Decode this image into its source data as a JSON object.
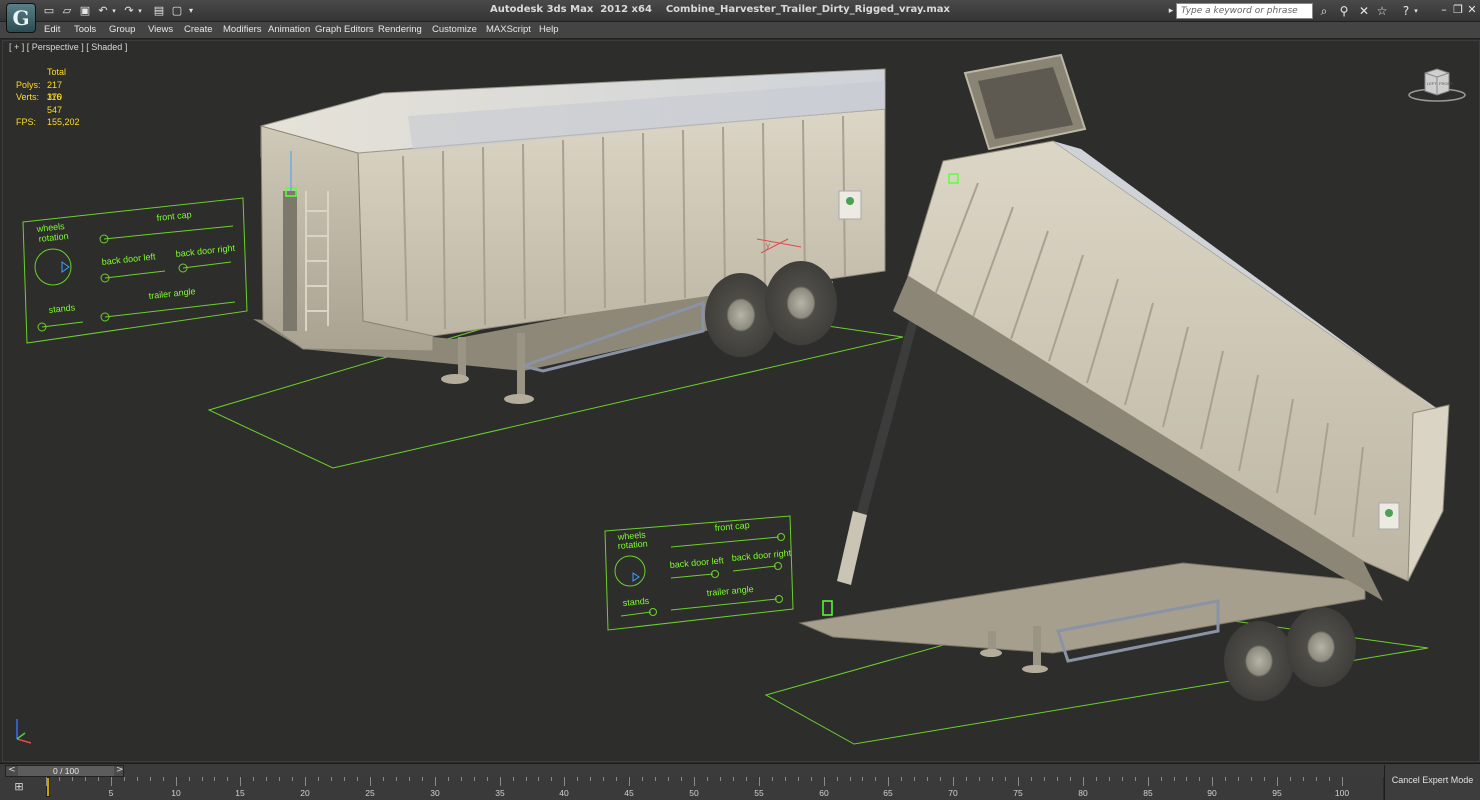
{
  "app": {
    "logo_glyph": "G",
    "title": "Autodesk 3ds Max  2012 x64    Combine_Harvester_Trailer_Dirty_Rigged_vray.max",
    "search_placeholder": "Type a keyword or phrase"
  },
  "quick_access": {
    "icons": [
      "new-file-icon",
      "open-folder-icon",
      "save-icon",
      "undo-icon",
      "redo-icon",
      "project-folder-icon",
      "viewport-layout-icon",
      "customize-dropdown-icon"
    ]
  },
  "menu": {
    "items": [
      "Edit",
      "Tools",
      "Group",
      "Views",
      "Create",
      "Modifiers",
      "Animation",
      "Graph Editors",
      "Rendering",
      "Customize",
      "MAXScript",
      "Help"
    ]
  },
  "viewport": {
    "label": "[ + ] [ Perspective ] [ Shaded ]",
    "stats": {
      "total_label": "Total",
      "polys_label": "Polys:",
      "polys_value": "217 370",
      "verts_label": "Verts:",
      "verts_value": "116 547",
      "fps_label": "FPS:",
      "fps_value": "155,202"
    },
    "viewcube": {
      "left_face": "LEFT",
      "front_face": "FRONT"
    },
    "rig_panel_1": {
      "wheels_line1": "wheels",
      "wheels_line2": "rotation",
      "front_cap": "front cap",
      "back_door_left": "back door left",
      "back_door_right": "back door right",
      "stands": "stands",
      "trailer_angle": "trailer angle"
    },
    "rig_panel_2": {
      "wheels_line1": "wheels",
      "wheels_line2": "rotation",
      "front_cap": "front cap",
      "back_door_left": "back door left",
      "back_door_right": "back door right",
      "stands": "stands",
      "trailer_angle": "trailer angle"
    },
    "gizmo_label": "y"
  },
  "timeline": {
    "slider_label": "0 / 100",
    "prev_arrow": "<",
    "next_arrow": ">",
    "ticks": [
      "0",
      "5",
      "10",
      "15",
      "20",
      "25",
      "30",
      "35",
      "40",
      "45",
      "50",
      "55",
      "60",
      "65",
      "70",
      "75",
      "80",
      "85",
      "90",
      "95",
      "100"
    ],
    "current_frame": 0,
    "total_frames": 100
  },
  "status": {
    "expert_button": "Cancel Expert Mode"
  },
  "colors": {
    "rig_green": "#7dff2a",
    "stats_yellow": "#ffdd22",
    "viewport_bg": "#2d2d2c"
  }
}
